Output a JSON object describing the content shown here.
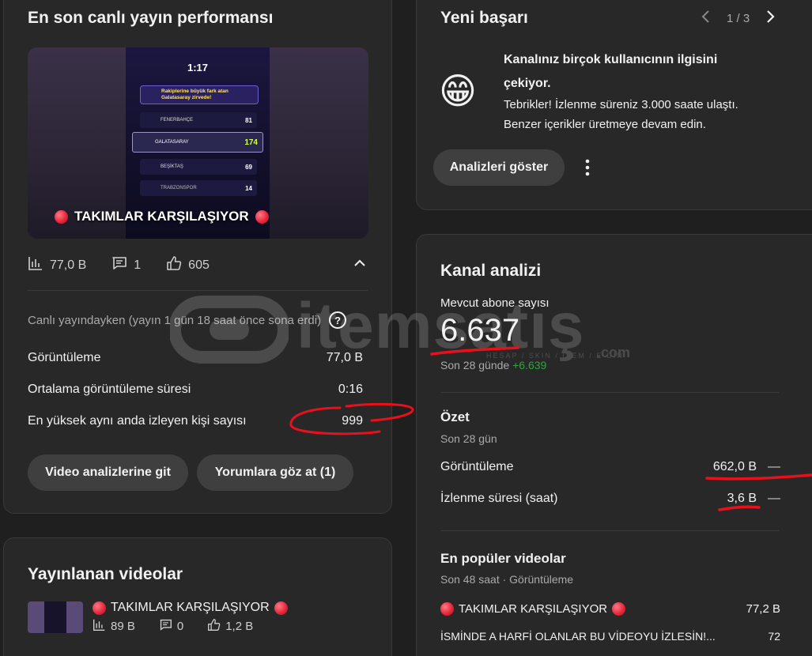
{
  "live": {
    "title": "En son canlı yayın performansı",
    "thumb_title": "TAKIMLAR KARŞILAŞIYOR",
    "thumb_timer": "1:17",
    "thumb_banner": "Rakiplerine büyük fark atan Galatasaray zirvede!",
    "thumb_teams": [
      {
        "name": "FENERBAHÇE",
        "score": "81"
      },
      {
        "name": "GALATASARAY",
        "score": "174"
      },
      {
        "name": "BEŞİKTAŞ",
        "score": "69"
      },
      {
        "name": "TRABZONSPOR",
        "score": "14"
      }
    ],
    "views": "77,0 B",
    "comments": "1",
    "likes": "605",
    "ended_text": "Canlı yayındayken (yayın 1 gün 18 saat önce sona erdi)",
    "metrics": [
      {
        "label": "Görüntüleme",
        "value": "77,0 B"
      },
      {
        "label": "Ortalama görüntüleme süresi",
        "value": "0:16"
      },
      {
        "label": "En yüksek aynı anda izleyen kişi sayısı",
        "value": "999"
      }
    ],
    "btn_analytics": "Video analizlerine git",
    "btn_comments": "Yorumlara göz at (1)"
  },
  "published": {
    "title": "Yayınlanan videolar",
    "video_title": "TAKIMLAR KARŞILAŞIYOR",
    "views": "89 B",
    "comments": "0",
    "likes": "1,2 B"
  },
  "achievement": {
    "title": "Yeni başarı",
    "pager": "1 / 3",
    "emoji": "😁",
    "headline": "Kanalınız birçok kullanıcının ilgisini çekiyor.",
    "body": "Tebrikler! İzlenme süreniz 3.000 saate ulaştı. Benzer içerikler üretmeye devam edin.",
    "btn": "Analizleri göster"
  },
  "channel": {
    "title": "Kanal analizi",
    "subs_label": "Mevcut abone sayısı",
    "subs_value": "6.637",
    "subs_change_prefix": "Son 28 günde",
    "subs_change": "+6.639",
    "summary_title": "Özet",
    "summary_period": "Son 28 gün",
    "summary": [
      {
        "label": "Görüntüleme",
        "value": "662,0 B",
        "trend": "—"
      },
      {
        "label": "İzlenme süresi (saat)",
        "value": "3,6 B",
        "trend": "—"
      }
    ],
    "top_title": "En popüler videolar",
    "top_period": "Son 48 saat · Görüntüleme",
    "top_videos": [
      {
        "title": "TAKIMLAR KARŞILAŞIYOR",
        "value": "77,2 B"
      },
      {
        "title": "İSMİNDE A HARFİ OLANLAR BU VİDEOYU İZLESİN!...",
        "value": "72"
      }
    ]
  },
  "watermark": {
    "brand": "itemsatış",
    "tagline": "HESAP / SKIN / ITEM / E-DİN",
    "suffix": ".com"
  },
  "colors": {
    "accent_green": "#2ba640",
    "annotation_red": "#e8101c"
  }
}
